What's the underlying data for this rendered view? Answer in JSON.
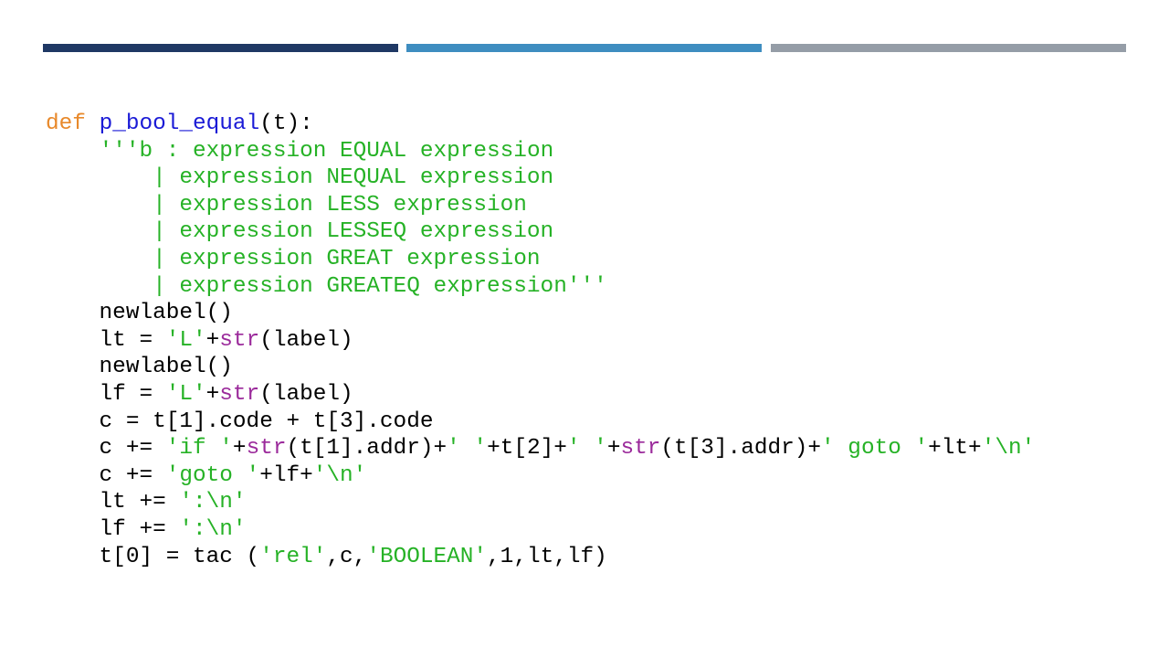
{
  "slide": {
    "header_bar_colors": [
      "#1f3864",
      "#3e8dc0",
      "#959da7"
    ]
  },
  "syntax_colors": {
    "keyword": "#e8892b",
    "function_name": "#1a1ad6",
    "string": "#26b226",
    "builtin": "#9b2a9b",
    "plain": "#000000"
  },
  "code": {
    "lines": [
      [
        {
          "t": "kw",
          "v": "def"
        },
        {
          "t": "pl",
          "v": " "
        },
        {
          "t": "fn",
          "v": "p_bool_equal"
        },
        {
          "t": "pl",
          "v": "(t):"
        }
      ],
      [
        {
          "t": "pl",
          "v": "    "
        },
        {
          "t": "str",
          "v": "'''b : expression EQUAL expression"
        }
      ],
      [
        {
          "t": "str",
          "v": "        | expression NEQUAL expression"
        }
      ],
      [
        {
          "t": "str",
          "v": "        | expression LESS expression"
        }
      ],
      [
        {
          "t": "str",
          "v": "        | expression LESSEQ expression"
        }
      ],
      [
        {
          "t": "str",
          "v": "        | expression GREAT expression"
        }
      ],
      [
        {
          "t": "str",
          "v": "        | expression GREATEQ expression'''"
        }
      ],
      [
        {
          "t": "pl",
          "v": "    newlabel()"
        }
      ],
      [
        {
          "t": "pl",
          "v": "    lt = "
        },
        {
          "t": "str",
          "v": "'L'"
        },
        {
          "t": "pl",
          "v": "+"
        },
        {
          "t": "bi",
          "v": "str"
        },
        {
          "t": "pl",
          "v": "(label)"
        }
      ],
      [
        {
          "t": "pl",
          "v": "    newlabel()"
        }
      ],
      [
        {
          "t": "pl",
          "v": "    lf = "
        },
        {
          "t": "str",
          "v": "'L'"
        },
        {
          "t": "pl",
          "v": "+"
        },
        {
          "t": "bi",
          "v": "str"
        },
        {
          "t": "pl",
          "v": "(label)"
        }
      ],
      [
        {
          "t": "pl",
          "v": "    c = t[1].code + t[3].code"
        }
      ],
      [
        {
          "t": "pl",
          "v": "    c += "
        },
        {
          "t": "str",
          "v": "'if '"
        },
        {
          "t": "pl",
          "v": "+"
        },
        {
          "t": "bi",
          "v": "str"
        },
        {
          "t": "pl",
          "v": "(t[1].addr)+"
        },
        {
          "t": "str",
          "v": "' '"
        },
        {
          "t": "pl",
          "v": "+t[2]+"
        },
        {
          "t": "str",
          "v": "' '"
        },
        {
          "t": "pl",
          "v": "+"
        },
        {
          "t": "bi",
          "v": "str"
        },
        {
          "t": "pl",
          "v": "(t[3].addr)+"
        },
        {
          "t": "str",
          "v": "' goto '"
        },
        {
          "t": "pl",
          "v": "+lt+"
        },
        {
          "t": "str",
          "v": "'\\n'"
        }
      ],
      [
        {
          "t": "pl",
          "v": "    c += "
        },
        {
          "t": "str",
          "v": "'goto '"
        },
        {
          "t": "pl",
          "v": "+lf+"
        },
        {
          "t": "str",
          "v": "'\\n'"
        }
      ],
      [
        {
          "t": "pl",
          "v": "    lt += "
        },
        {
          "t": "str",
          "v": "':\\n'"
        }
      ],
      [
        {
          "t": "pl",
          "v": "    lf += "
        },
        {
          "t": "str",
          "v": "':\\n'"
        }
      ],
      [
        {
          "t": "pl",
          "v": "    t[0] = tac ("
        },
        {
          "t": "str",
          "v": "'rel'"
        },
        {
          "t": "pl",
          "v": ",c,"
        },
        {
          "t": "str",
          "v": "'BOOLEAN'"
        },
        {
          "t": "pl",
          "v": ",1,lt,lf)"
        }
      ]
    ]
  }
}
